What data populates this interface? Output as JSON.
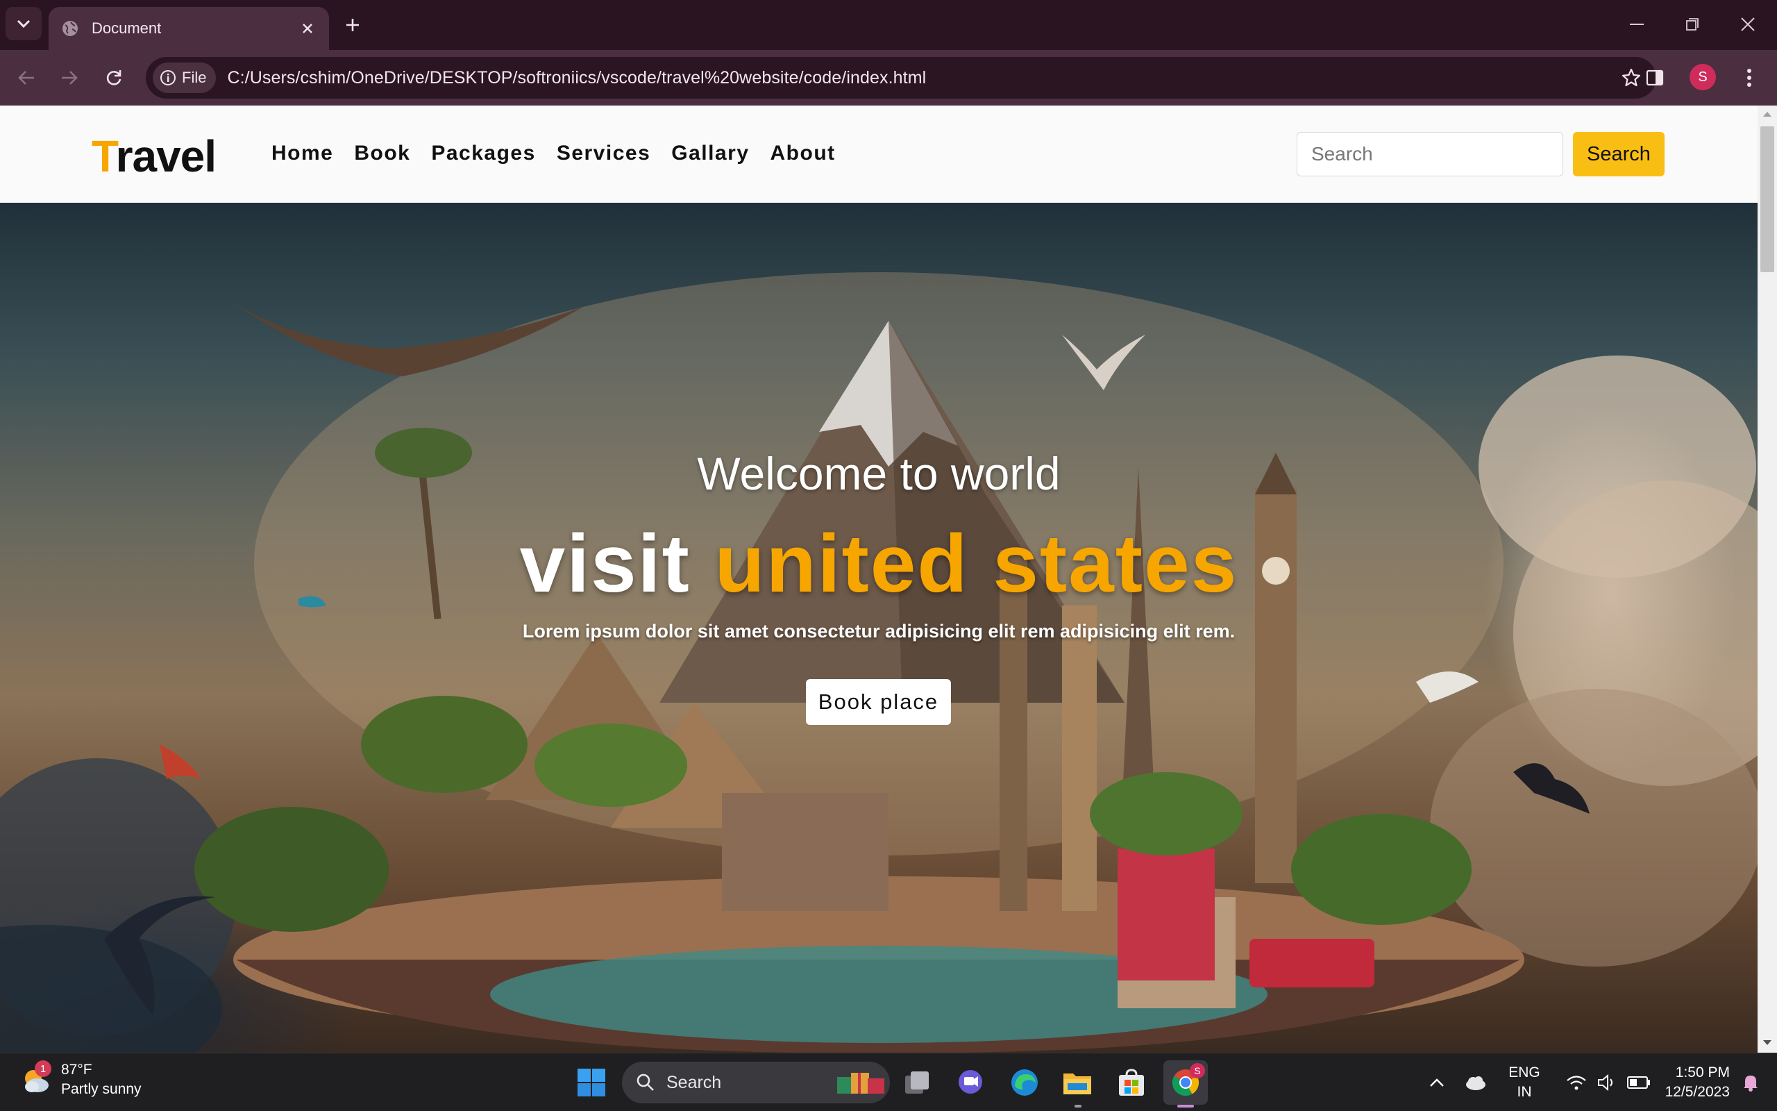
{
  "browser": {
    "tab_title": "Document",
    "url_chip_label": "File",
    "url": "C:/Users/cshim/OneDrive/DESKTOP/softroniics/vscode/travel%20website/code/index.html",
    "profile_initial": "S"
  },
  "site": {
    "logo_first": "T",
    "logo_rest": "ravel",
    "nav": [
      "Home",
      "Book",
      "Packages",
      "Services",
      "Gallary",
      "About"
    ],
    "search_placeholder": "Search",
    "search_button": "Search"
  },
  "hero": {
    "welcome": "Welcome to world",
    "title_white": "visit ",
    "title_highlight": "united states",
    "subtitle": "Lorem ipsum dolor sit amet consectetur adipisicing elit rem adipisicing elit rem.",
    "button": "Book place"
  },
  "taskbar": {
    "weather_temp": "87°F",
    "weather_desc": "Partly sunny",
    "weather_badge": "1",
    "search_label": "Search",
    "lang_1": "ENG",
    "lang_2": "IN",
    "time": "1:50 PM",
    "date": "12/5/2023",
    "chrome_badge": "S"
  },
  "colors": {
    "accent": "#f7a600",
    "search_button": "#f9be13",
    "browser_frame": "#4c2e41",
    "tab_strip": "#2a1421"
  }
}
